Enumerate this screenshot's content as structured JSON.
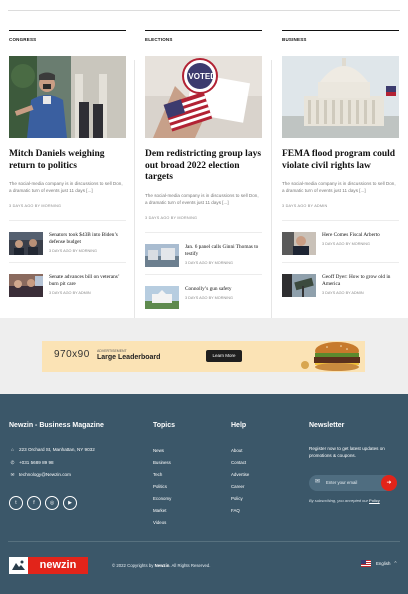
{
  "columns": [
    {
      "category": "CONGRESS",
      "title": "Mitch Daniels weighing return to politics",
      "excerpt": "The social-media company is in discussions to sell Don, a dramatic turn of events just 11 days [...]",
      "meta": "3 DAYS AGO BY MORNING",
      "items": [
        {
          "title": "Senators took $43B into Biden’s defense budget",
          "meta": "3 DAYS AGO BY MORNING"
        },
        {
          "title": "Senate advances bill on veterans’ burn pit care",
          "meta": "3 DAYS AGO BY ADMIN"
        }
      ]
    },
    {
      "category": "ELECTIONS",
      "title": "Dem redistricting group lays out broad 2022 election targets",
      "excerpt": "The social-media company is in discussions to sell Don, a dramatic turn of events just 11 days [...]",
      "meta": "3 DAYS AGO BY MORNING",
      "hero_badge": "I VOTED",
      "items": [
        {
          "title": "Jan. 6 panel calls Ginni Thomas to testify",
          "meta": "3 DAYS AGO BY MORNING"
        },
        {
          "title": "Connolly’s gun safety",
          "meta": "3 DAYS AGO BY MORNING"
        }
      ]
    },
    {
      "category": "BUSINESS",
      "title": "FEMA flood program could violate civil rights law",
      "excerpt": "The social-media company is in discussions to sell Don, a dramatic turn of events just 11 days [...]",
      "meta": "3 DAYS AGO BY ADMIN",
      "items": [
        {
          "title": "Here Comes Fiscal Arberto",
          "meta": "3 DAYS AGO BY MORNING"
        },
        {
          "title": "Geoff Dyer: How to grow old in America",
          "meta": "3 DAYS AGO BY ADMIN"
        }
      ]
    }
  ],
  "ad": {
    "size": "970x90",
    "small": "ADVERTISEMENT",
    "title": "Large Leaderboard",
    "button": "Learn More"
  },
  "footer": {
    "brand_heading": "Newzin - Business Magazine",
    "address": "223 Orchard St, Manhattan, NY 9032",
    "phone": "+031 5689 89 98",
    "email": "technology@Newzin.com",
    "topics_heading": "Topics",
    "topics": [
      "News",
      "Business",
      "Tech",
      "Politics",
      "Economy",
      "Market",
      "Videos"
    ],
    "help_heading": "Help",
    "help": [
      "About",
      "Contact",
      "Advertise",
      "Career",
      "Policy",
      "FAQ"
    ],
    "newsletter_heading": "Newsletter",
    "newsletter_text": "Register now to get latest updates on promotions & coupons.",
    "email_placeholder": "Enter your email",
    "subscribe_note": "By subscribing, you accepted our",
    "policy_link": "Policy",
    "logo_text": "newzin",
    "copyright_prefix": "© 2022 Copyrights by",
    "copyright_brand": "Newzin",
    "copyright_suffix": ". All Rights Reserved.",
    "language": "English"
  },
  "colors": {
    "footer_bg": "#3b5769",
    "accent_red": "#e2241a",
    "ad_bg": "#fbe3b5"
  }
}
